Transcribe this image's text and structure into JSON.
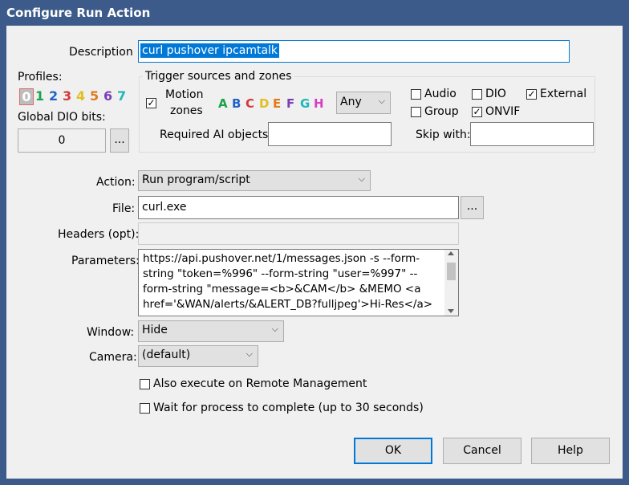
{
  "window": {
    "title": "Configure Run Action"
  },
  "description": {
    "label": "Description",
    "value": "curl pushover ipcamtalk"
  },
  "profiles": {
    "label": "Profiles:",
    "items": [
      {
        "n": "0",
        "color": "#ffffff",
        "bg": "#b0b0b0"
      },
      {
        "n": "1",
        "color": "#1aa34a"
      },
      {
        "n": "2",
        "color": "#1f63c7"
      },
      {
        "n": "3",
        "color": "#d23a3a"
      },
      {
        "n": "4",
        "color": "#e0c020"
      },
      {
        "n": "5",
        "color": "#e07a1a"
      },
      {
        "n": "6",
        "color": "#7b3fb5"
      },
      {
        "n": "7",
        "color": "#21b7b7"
      }
    ]
  },
  "global_dio": {
    "label": "Global DIO bits:",
    "value": "0",
    "button": "..."
  },
  "trigger": {
    "title": "Trigger sources and zones",
    "motion_label_1": "Motion",
    "motion_label_2": "zones",
    "zones": [
      {
        "l": "A",
        "color": "#1aa34a"
      },
      {
        "l": "B",
        "color": "#1f63c7"
      },
      {
        "l": "C",
        "color": "#d23a3a"
      },
      {
        "l": "D",
        "color": "#e0c020"
      },
      {
        "l": "E",
        "color": "#e07a1a"
      },
      {
        "l": "F",
        "color": "#7b3fb5"
      },
      {
        "l": "G",
        "color": "#21b7b7"
      },
      {
        "l": "H",
        "color": "#d63fc4"
      }
    ],
    "zone_select": "Any",
    "audio": "Audio",
    "dio": "DIO",
    "external": "External",
    "group": "Group",
    "onvif": "ONVIF",
    "required_ai_label": "Required AI objects:",
    "required_ai_value": "",
    "skip_with_label": "Skip with:",
    "skip_with_value": ""
  },
  "action": {
    "label": "Action:",
    "value": "Run program/script"
  },
  "file": {
    "label": "File:",
    "value": "curl.exe",
    "button": "..."
  },
  "headers": {
    "label": "Headers (opt):",
    "value": ""
  },
  "parameters": {
    "label": "Parameters:",
    "lines": [
      "https://api.pushover.net/1/messages.json -s --form-",
      "string \"token=%996\" --form-string \"user=%997\" --",
      "form-string \"message=<b>&CAM</b> &MEMO <a",
      "href='&WAN/alerts/&ALERT_DB?fulljpeg'>Hi-Res</a>"
    ]
  },
  "window_opt": {
    "label": "Window:",
    "value": "Hide"
  },
  "camera": {
    "label": "Camera:",
    "value": "(default)"
  },
  "also_execute": {
    "label": "Also execute on Remote Management"
  },
  "wait_process": {
    "label": "Wait for process to complete (up to 30 seconds)"
  },
  "buttons": {
    "ok": "OK",
    "cancel": "Cancel",
    "help": "Help"
  },
  "check_mark": "✓",
  "chevron": "⌵"
}
